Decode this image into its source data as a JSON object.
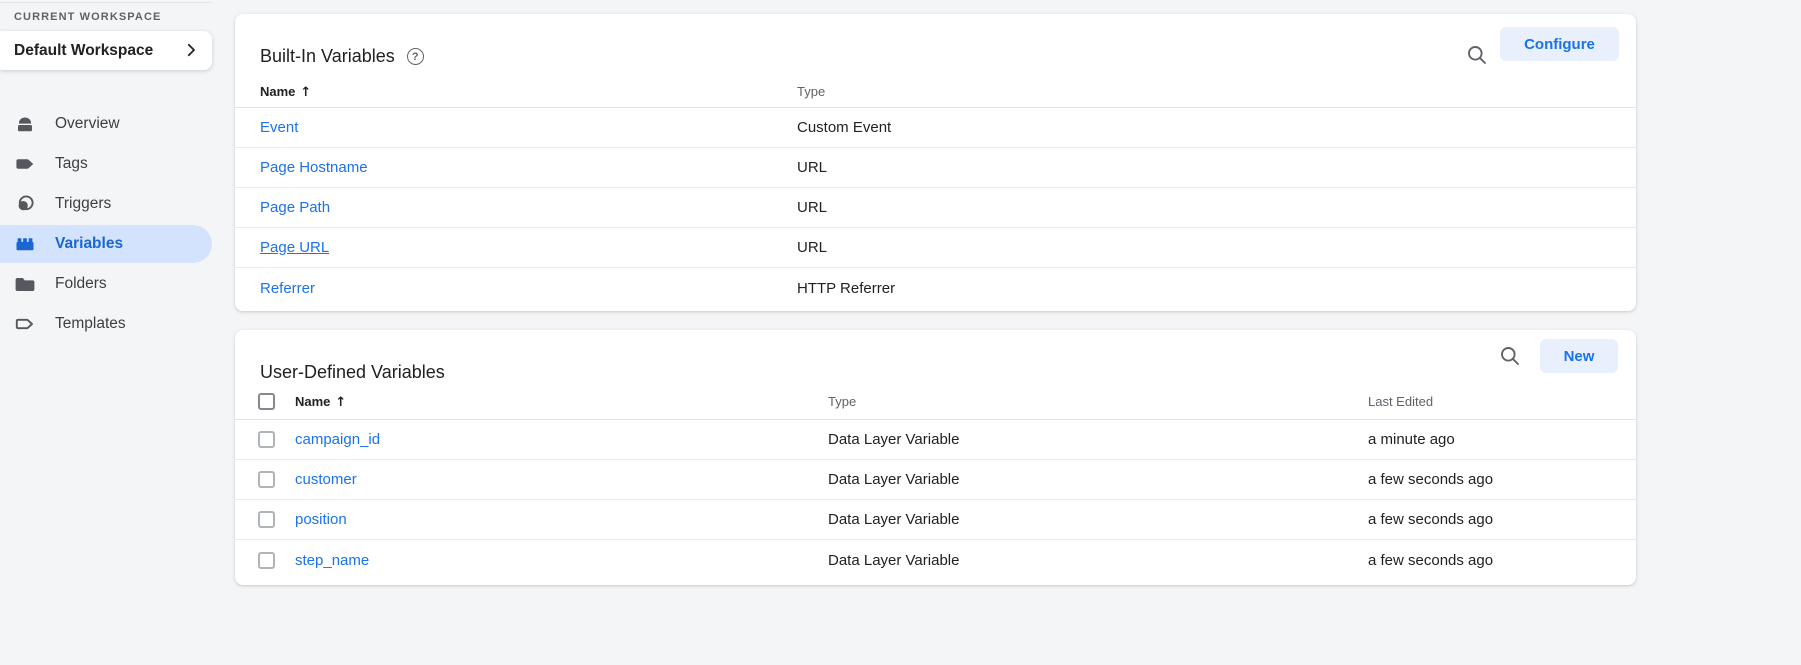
{
  "colors": {
    "page_bg": "#f4f5f7",
    "card_bg": "#ffffff",
    "link_blue": "#1a73e8",
    "accent_button_bg": "#e8f0fe",
    "accent_button_text": "#1a73e8",
    "selected_nav_bg": "#d3e3fd",
    "selected_nav_text": "#1967d2",
    "text_primary": "#202124",
    "text_secondary": "#5f6368",
    "divider": "#e9eaec"
  },
  "sidebar": {
    "section_label": "CURRENT WORKSPACE",
    "workspace_name": "Default Workspace",
    "items": [
      {
        "label": "Overview",
        "icon": "overview-icon",
        "selected": false
      },
      {
        "label": "Tags",
        "icon": "tag-icon",
        "selected": false
      },
      {
        "label": "Triggers",
        "icon": "trigger-icon",
        "selected": false
      },
      {
        "label": "Variables",
        "icon": "variables-brick-icon",
        "selected": true
      },
      {
        "label": "Folders",
        "icon": "folder-icon",
        "selected": false
      },
      {
        "label": "Templates",
        "icon": "template-icon",
        "selected": false
      }
    ]
  },
  "builtin": {
    "title": "Built-In Variables",
    "help_icon_glyph": "?",
    "configure_label": "Configure",
    "columns": {
      "name": "Name",
      "type": "Type",
      "sort_arrow": "↑"
    },
    "rows": [
      {
        "name": "Event",
        "type": "Custom Event",
        "underlined": false
      },
      {
        "name": "Page Hostname",
        "type": "URL",
        "underlined": false
      },
      {
        "name": "Page Path",
        "type": "URL",
        "underlined": false
      },
      {
        "name": "Page URL",
        "type": "URL",
        "underlined": true
      },
      {
        "name": "Referrer",
        "type": "HTTP Referrer",
        "underlined": false
      }
    ]
  },
  "user_defined": {
    "title": "User-Defined Variables",
    "new_label": "New",
    "columns": {
      "name": "Name",
      "type": "Type",
      "last_edited": "Last Edited",
      "sort_arrow": "↑"
    },
    "rows": [
      {
        "name": "campaign_id",
        "type": "Data Layer Variable",
        "last_edited": "a minute ago",
        "checked": false
      },
      {
        "name": "customer",
        "type": "Data Layer Variable",
        "last_edited": "a few seconds ago",
        "checked": false
      },
      {
        "name": "position",
        "type": "Data Layer Variable",
        "last_edited": "a few seconds ago",
        "checked": false
      },
      {
        "name": "step_name",
        "type": "Data Layer Variable",
        "last_edited": "a few seconds ago",
        "checked": false
      }
    ]
  }
}
